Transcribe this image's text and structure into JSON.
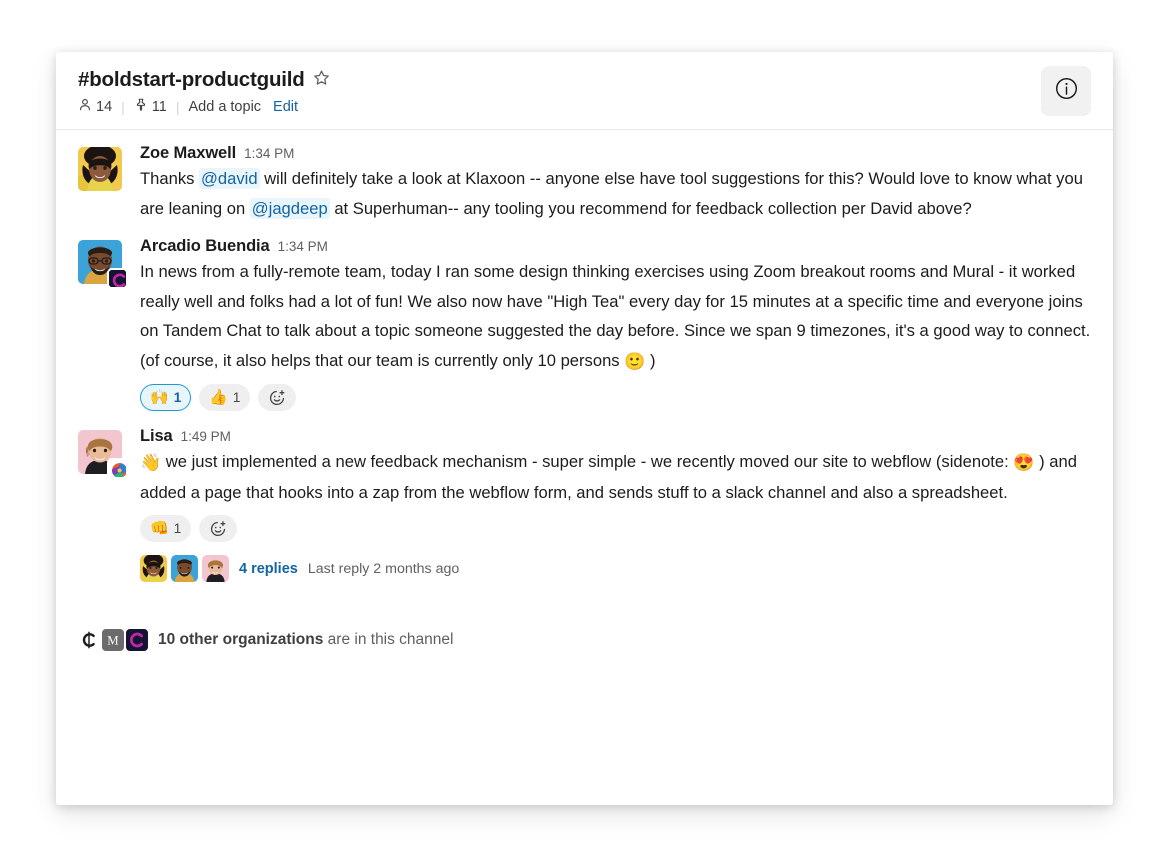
{
  "channel": {
    "name": "#boldstart-productguild",
    "star_icon": "star-outline-icon",
    "members_icon": "person-icon",
    "members_count": "14",
    "pins_icon": "pin-icon",
    "pins_count": "11",
    "topic_placeholder": "Add a topic",
    "edit_label": "Edit",
    "info_icon": "info-circle-icon",
    "separator": "|"
  },
  "messages": [
    {
      "author": "Zoe Maxwell",
      "timestamp": "1:34 PM",
      "avatar": "zoe-avatar",
      "badge": null,
      "text_parts": [
        {
          "t": "text",
          "v": "Thanks "
        },
        {
          "t": "mention",
          "v": "@david"
        },
        {
          "t": "text",
          "v": " will definitely take a look at Klaxoon -- anyone else have tool suggestions for this? Would love to know what you are leaning on "
        },
        {
          "t": "mention",
          "v": "@jagdeep"
        },
        {
          "t": "text",
          "v": " at Superhuman-- any tooling you recommend for feedback collection per David above?"
        }
      ],
      "reactions": [],
      "thread": null
    },
    {
      "author": "Arcadio Buendia",
      "timestamp": "1:34 PM",
      "avatar": "arcadio-avatar",
      "badge": "coda-org-badge",
      "text_parts": [
        {
          "t": "text",
          "v": "In news from a fully-remote team, today I ran some design thinking exercises using Zoom breakout rooms and Mural - it worked really well and folks had a lot of fun! We also now have \"High Tea\" every day for 15 minutes at a specific time and everyone joins on Tandem Chat to talk about a topic someone suggested the day before. Since we span 9 timezones, it's a good way to connect. (of course, it also helps that our team is currently only 10 persons "
        },
        {
          "t": "emoji",
          "v": "🙂"
        },
        {
          "t": "text",
          "v": " )"
        }
      ],
      "reactions": [
        {
          "emoji": "🙌",
          "name": "raising-hands-reaction",
          "count": "1",
          "active": true
        },
        {
          "emoji": "👍",
          "name": "thumbs-up-reaction",
          "count": "1",
          "active": false
        }
      ],
      "add_reaction_icon": "add-reaction-icon",
      "thread": null
    },
    {
      "author": "Lisa",
      "timestamp": "1:49 PM",
      "avatar": "lisa-avatar",
      "badge": "swirl-org-badge",
      "text_parts": [
        {
          "t": "emoji",
          "v": "👋"
        },
        {
          "t": "text",
          "v": " we just implemented a new feedback mechanism - super simple - we recently moved our site to webflow (sidenote: "
        },
        {
          "t": "emoji",
          "v": "😍"
        },
        {
          "t": "text",
          "v": " ) and added a page that hooks into a zap from the webflow form, and sends stuff to a slack channel and also a spreadsheet."
        }
      ],
      "reactions": [
        {
          "emoji": "👊",
          "name": "fist-bump-reaction",
          "count": "1",
          "active": false
        }
      ],
      "add_reaction_icon": "add-reaction-icon",
      "thread": {
        "replies_label": "4 replies",
        "last_reply_label": "Last reply 2 months ago",
        "participants": [
          "zoe-thread-avatar",
          "arcadio-thread-avatar",
          "lisa-thread-avatar"
        ]
      }
    }
  ],
  "footer": {
    "orgs_count_label": "10 other organizations",
    "orgs_suffix": " are in this channel",
    "org_icons": [
      "org-icon-c",
      "org-icon-m",
      "org-icon-coda"
    ]
  },
  "colors": {
    "link": "#1264a3",
    "mention_bg": "#e8f5fa",
    "text": "#1d1c1d",
    "muted": "#616061",
    "reaction_active_border": "#1d9bd1"
  }
}
